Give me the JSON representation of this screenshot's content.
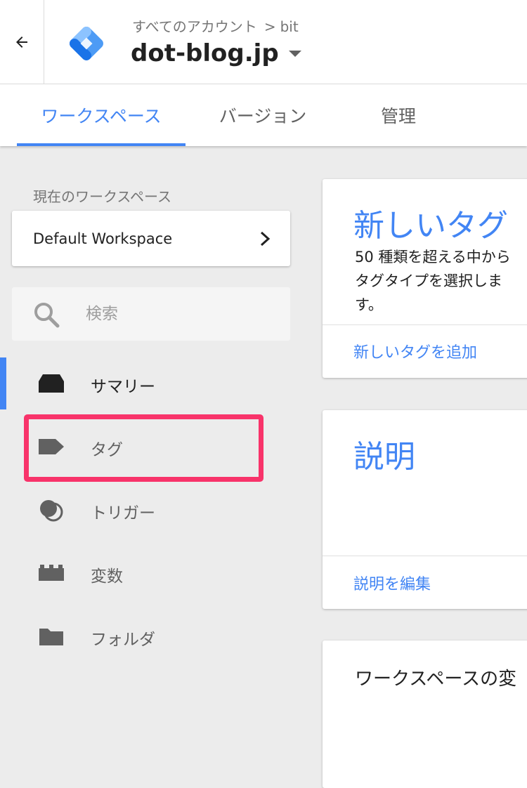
{
  "header": {
    "breadcrumb": {
      "parent": "すべてのアカウント",
      "separator": ">",
      "account": "bit"
    },
    "container_name": "dot-blog.jp"
  },
  "tabs": [
    {
      "label": "ワークスペース",
      "active": true
    },
    {
      "label": "バージョン"
    },
    {
      "label": "管理"
    }
  ],
  "sidebar": {
    "workspace_label": "現在のワークスペース",
    "workspace_name": "Default Workspace",
    "search": {
      "placeholder": "検索"
    },
    "items": [
      {
        "label": "サマリー",
        "icon": "inbox-icon",
        "active": true
      },
      {
        "label": "タグ",
        "icon": "tag-icon",
        "highlighted": true
      },
      {
        "label": "トリガー",
        "icon": "trigger-icon"
      },
      {
        "label": "変数",
        "icon": "variables-icon"
      },
      {
        "label": "フォルダ",
        "icon": "folder-icon"
      }
    ]
  },
  "cards": {
    "new_tag": {
      "title": "新しいタグ",
      "lines": [
        "50 種類を超える中から",
        "タグタイプを選択しま",
        "す。"
      ],
      "link": "新しいタグを追加"
    },
    "description": {
      "title": "説明",
      "link": "説明を編集"
    },
    "workspace_changes": {
      "title": "ワークスペースの変"
    }
  },
  "colors": {
    "accent": "#4285f4",
    "highlight": "#f8336a",
    "background": "#ececec"
  }
}
